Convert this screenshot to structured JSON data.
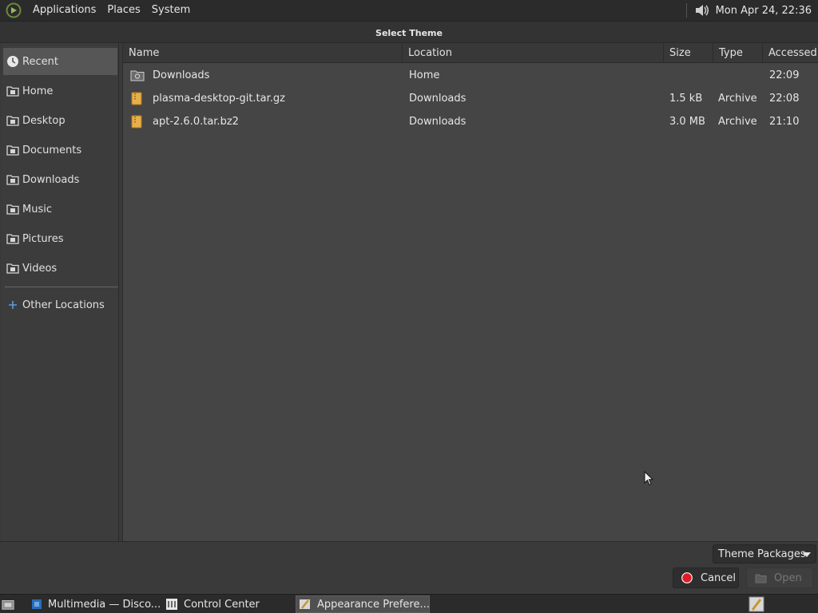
{
  "top_panel": {
    "menus": [
      "Applications",
      "Places",
      "System"
    ],
    "clock": "Mon Apr 24, 22:36"
  },
  "dialog": {
    "title": "Select Theme"
  },
  "sidebar": {
    "items": [
      {
        "label": "Recent",
        "icon": "recent-icon",
        "active": true
      },
      {
        "label": "Home",
        "icon": "folder-icon"
      },
      {
        "label": "Desktop",
        "icon": "folder-icon"
      },
      {
        "label": "Documents",
        "icon": "folder-icon"
      },
      {
        "label": "Downloads",
        "icon": "folder-icon"
      },
      {
        "label": "Music",
        "icon": "folder-icon"
      },
      {
        "label": "Pictures",
        "icon": "folder-icon"
      },
      {
        "label": "Videos",
        "icon": "folder-icon"
      },
      {
        "label": "Other Locations",
        "icon": "plus-icon"
      }
    ]
  },
  "filelist": {
    "columns": [
      "Name",
      "Location",
      "Size",
      "Type",
      "Accessed"
    ],
    "rows": [
      {
        "name": "Downloads",
        "location": "Home",
        "size": "",
        "type": "",
        "accessed": "22:09",
        "icon": "folder-icon"
      },
      {
        "name": "plasma-desktop-git.tar.gz",
        "location": "Downloads",
        "size": "1.5 kB",
        "type": "Archive",
        "accessed": "22:08",
        "icon": "archive-icon"
      },
      {
        "name": "apt-2.6.0.tar.bz2",
        "location": "Downloads",
        "size": "3.0 MB",
        "type": "Archive",
        "accessed": "21:10",
        "icon": "archive-icon"
      }
    ]
  },
  "footer": {
    "filter": "Theme Packages",
    "cancel": "Cancel",
    "open": "Open"
  },
  "taskbar": {
    "tasks": [
      {
        "label": "Multimedia — Disco...",
        "icon": "multimedia-icon"
      },
      {
        "label": "Control Center",
        "icon": "control-center-icon"
      },
      {
        "label": "Appearance Prefere...",
        "icon": "appearance-icon",
        "active": true
      }
    ]
  },
  "colors": {
    "panel_bg": "#2b2b2b",
    "list_bg": "#454545",
    "sidebar_active": "#565656",
    "archive_icon": "#e8b04a",
    "cancel_red": "#e01b24"
  }
}
